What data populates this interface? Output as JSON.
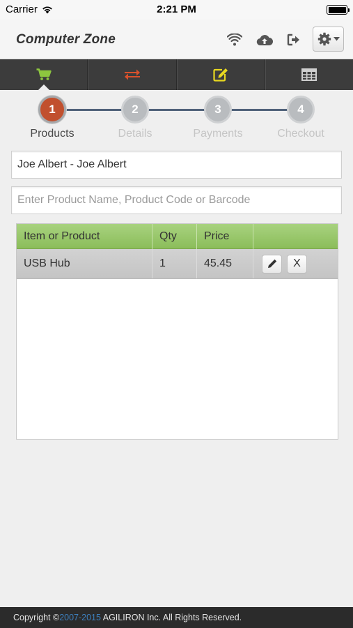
{
  "status_bar": {
    "carrier": "Carrier",
    "time": "2:21 PM"
  },
  "header": {
    "title": "Computer Zone",
    "icons": [
      "wifi-icon",
      "cloud-upload-icon",
      "logout-icon",
      "gear-icon",
      "caret-down-icon"
    ]
  },
  "tabs": [
    {
      "icon": "cart-icon",
      "color": "#8dc63f",
      "active": true
    },
    {
      "icon": "transfer-icon",
      "color": "#d9512c",
      "active": false
    },
    {
      "icon": "edit-icon",
      "color": "#e8d820",
      "active": false
    },
    {
      "icon": "table-icon",
      "color": "#cfcfcf",
      "active": false
    }
  ],
  "steps": [
    {
      "number": "1",
      "label": "Products",
      "active": true
    },
    {
      "number": "2",
      "label": "Details",
      "active": false
    },
    {
      "number": "3",
      "label": "Payments",
      "active": false
    },
    {
      "number": "4",
      "label": "Checkout",
      "active": false
    }
  ],
  "customer": {
    "value": "Joe Albert - Joe Albert"
  },
  "product_search": {
    "placeholder": "Enter Product Name, Product Code or Barcode",
    "value": ""
  },
  "table": {
    "headers": [
      "Item or Product",
      "Qty",
      "Price",
      ""
    ],
    "rows": [
      {
        "item": "USB Hub",
        "qty": "1",
        "price": "45.45",
        "remove_label": "X"
      }
    ]
  },
  "footer": {
    "prefix": "Copyright ©",
    "years": "2007-2015",
    "suffix": " AGILIRON Inc. All Rights Reserved."
  },
  "colors": {
    "accent_green": "#8dc63f",
    "active_step": "#c1502e",
    "tab_bar": "#3c3c3c",
    "footer_link": "#3d7fbd"
  }
}
